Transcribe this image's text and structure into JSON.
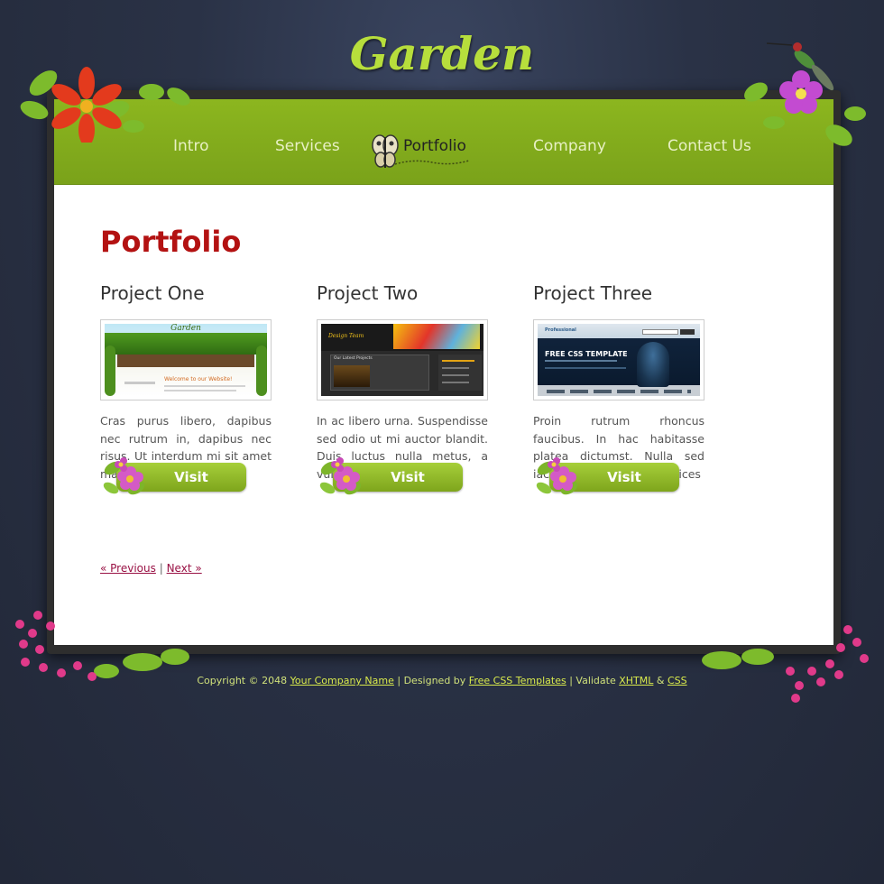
{
  "site": {
    "title": "Garden"
  },
  "nav": {
    "items": [
      {
        "label": "Intro"
      },
      {
        "label": "Services"
      },
      {
        "label": "Portfolio"
      },
      {
        "label": "Company"
      },
      {
        "label": "Contact Us"
      }
    ],
    "active": "Portfolio"
  },
  "main": {
    "heading": "Portfolio",
    "projects": [
      {
        "title": "Project One",
        "description": "Cras purus libero, dapibus nec rutrum in, dapibus nec risus. Ut interdum mi sit amet magna feugiat auctor.",
        "button": "Visit",
        "thumb_text_1": "Garden",
        "thumb_text_2": "Welcome to our Website!"
      },
      {
        "title": "Project Two",
        "description": "In ac libero urna. Suspendisse sed odio ut mi auctor blandit. Duis luctus nulla metus, a vulputate mauris.",
        "button": "Visit",
        "thumb_text_1": "Design Team",
        "thumb_text_2": "Our Latest Projects"
      },
      {
        "title": "Project Three",
        "description": "Proin rutrum rhoncus faucibus. In hac habitasse platea dictumst. Nulla sed iaculis risus phasellus ultrices",
        "button": "Visit",
        "thumb_text_1": "Professional",
        "thumb_text_2": "FREE CSS TEMPLATE"
      }
    ],
    "pager": {
      "previous": "« Previous",
      "separator": "|",
      "next": "Next »"
    }
  },
  "footer": {
    "copyright": "Copyright © 2048",
    "company_link": "Your Company Name",
    "designed_by": "| Designed by",
    "designer_link": "Free CSS Templates",
    "validate": "| Validate",
    "xhtml_link": "XHTML",
    "amp": "&",
    "css_link": "CSS"
  },
  "colors": {
    "accent_green": "#8cb61f",
    "heading_red": "#b31212",
    "title_green": "#b7de3c",
    "link_magenta": "#991144"
  },
  "icons": [
    "butterfly-icon",
    "flower-icon",
    "hummingbird-icon"
  ]
}
